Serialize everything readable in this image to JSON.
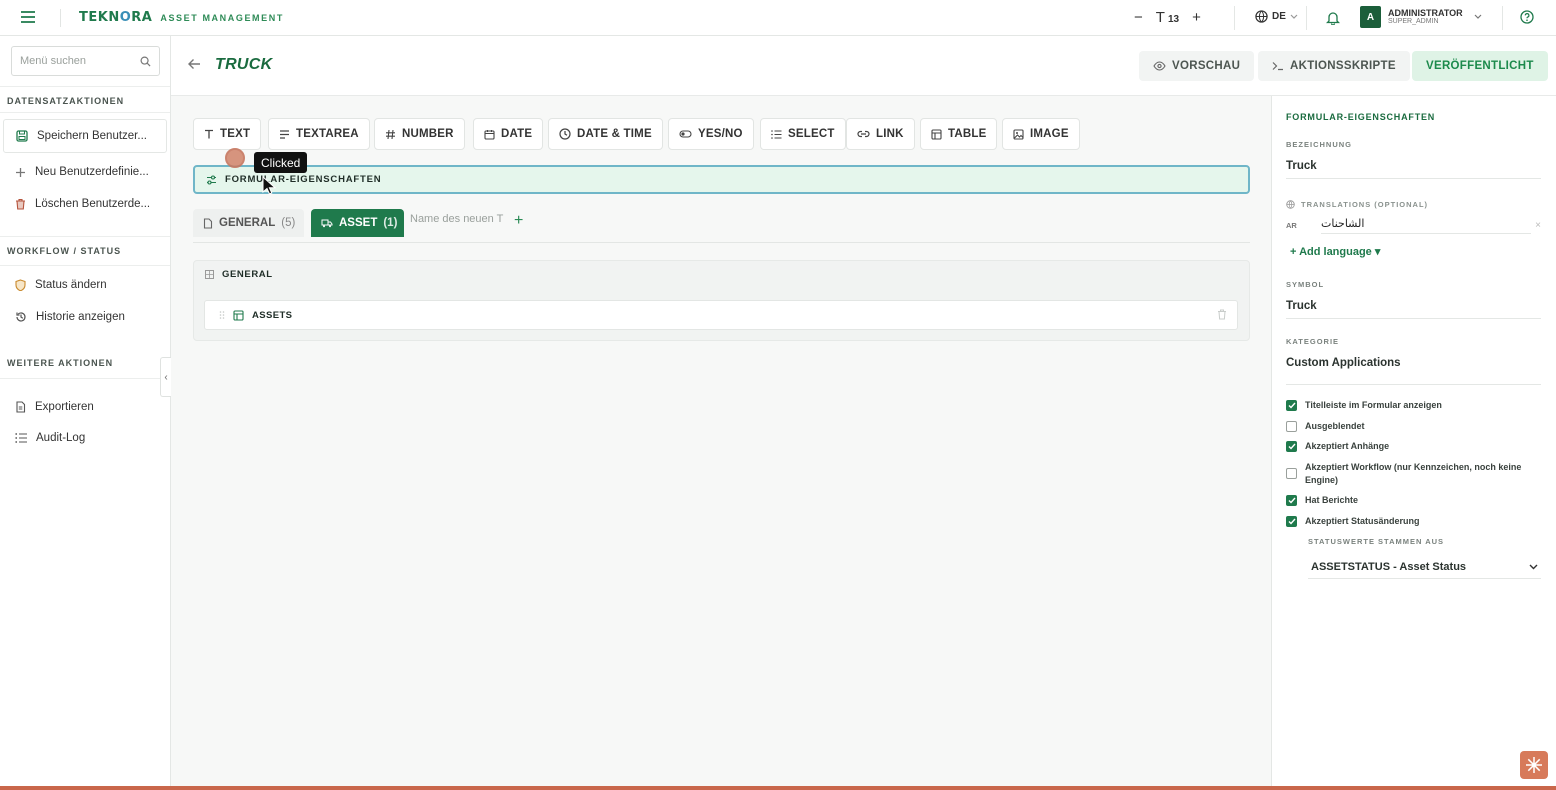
{
  "topbar": {
    "brand_logo_a": "TEKN",
    "brand_logo_b": "O",
    "brand_logo_c": "RA",
    "brand_sub": "ASSET MANAGEMENT",
    "font_decrease": "−",
    "font_icon": "T",
    "font_size": "13",
    "font_increase": "+",
    "language": "DE",
    "user_name": "ADMINISTRATOR",
    "user_role": "SUPER_ADMIN",
    "avatar_letter": "A"
  },
  "sidebar": {
    "search_placeholder": "Menü suchen",
    "sections": [
      {
        "heading": "DATENSATZAKTIONEN",
        "items": [
          {
            "label": "Speichern Benutzer...",
            "icon": "save-icon"
          },
          {
            "label": "Neu Benutzerdefinie...",
            "icon": "plus-icon"
          },
          {
            "label": "Löschen Benutzerde...",
            "icon": "trash-icon"
          }
        ]
      },
      {
        "heading": "WORKFLOW / STATUS",
        "items": [
          {
            "label": "Status ändern",
            "icon": "shield-icon"
          },
          {
            "label": "Historie anzeigen",
            "icon": "history-icon"
          }
        ]
      },
      {
        "heading": "WEITERE AKTIONEN",
        "items": [
          {
            "label": "Exportieren",
            "icon": "file-icon"
          },
          {
            "label": "Audit-Log",
            "icon": "list-icon"
          }
        ]
      }
    ],
    "collapse_glyph": "‹"
  },
  "header": {
    "title": "TRUCK",
    "preview_label": "VORSCHAU",
    "scripts_label": "AKTIONSSKRIPTE",
    "publish_label": "VERÖFFENTLICHT"
  },
  "field_types": [
    {
      "label": "TEXT",
      "icon": "text-icon"
    },
    {
      "label": "TEXTAREA",
      "icon": "textarea-icon"
    },
    {
      "label": "NUMBER",
      "icon": "hash-icon"
    },
    {
      "label": "DATE",
      "icon": "calendar-icon"
    },
    {
      "label": "DATE & TIME",
      "icon": "clock-icon"
    },
    {
      "label": "YES/NO",
      "icon": "toggle-icon"
    },
    {
      "label": "SELECT",
      "icon": "list-icon"
    },
    {
      "label": "LINK",
      "icon": "link-icon"
    },
    {
      "label": "TABLE",
      "icon": "table-icon"
    },
    {
      "label": "IMAGE",
      "icon": "image-icon"
    }
  ],
  "form_properties_bar": "FORMULAR-EIGENSCHAFTEN",
  "tabs": {
    "general_label": "GENERAL",
    "general_count": "(5)",
    "asset_label": "ASSET",
    "asset_count": "(1)",
    "new_tab_placeholder": "Name des neuen T",
    "add_glyph": "+"
  },
  "section": {
    "title": "GENERAL",
    "row_label": "ASSETS"
  },
  "click_tooltip": "Clicked",
  "right_panel": {
    "title": "FORMULAR-EIGENSCHAFTEN",
    "bezeichnung_label": "BEZEICHNUNG",
    "bezeichnung_value": "Truck",
    "translations_label": "TRANSLATIONS (OPTIONAL)",
    "translation_code": "AR",
    "translation_value": "الشاحنات",
    "translation_remove": "×",
    "add_language": "+ Add language ▾",
    "symbol_label": "SYMBOL",
    "symbol_value": "Truck",
    "kategorie_label": "KATEGORIE",
    "kategorie_value": "Custom Applications",
    "checkboxes": [
      {
        "label": "Titelleiste im Formular anzeigen",
        "checked": true
      },
      {
        "label": "Ausgeblendet",
        "checked": false
      },
      {
        "label": "Akzeptiert Anhänge",
        "checked": true
      },
      {
        "label": "Akzeptiert Workflow (nur Kennzeichen, noch keine Engine)",
        "checked": false
      },
      {
        "label": "Hat Berichte",
        "checked": true
      },
      {
        "label": "Akzeptiert Statusänderung",
        "checked": true
      }
    ],
    "status_source_label": "STATUSWERTE STAMMEN AUS",
    "status_source_value": "ASSETSTATUS - Asset Status"
  },
  "colors": {
    "brand_green": "#1f7a4c",
    "active_tab": "#1f7a4c",
    "publish_bg": "#dff3e6",
    "highlight_bar": "#e5f6ec",
    "click_marker": "#d38a72"
  }
}
